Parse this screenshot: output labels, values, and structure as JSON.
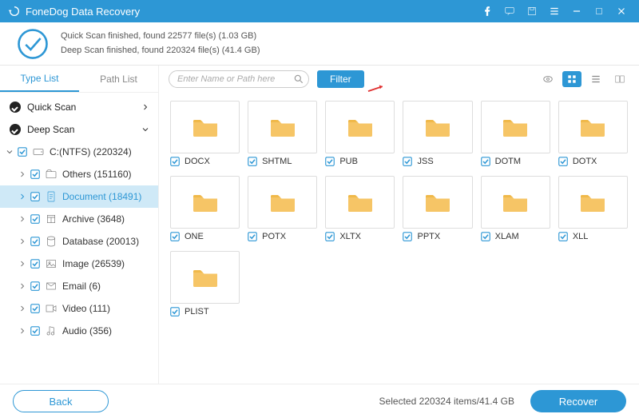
{
  "titlebar": {
    "app_name": "FoneDog Data Recovery"
  },
  "status": {
    "line1": "Quick Scan finished, found 22577 file(s) (1.03 GB)",
    "line2": "Deep Scan finished, found 220324 file(s) (41.4 GB)"
  },
  "sidebar": {
    "tabs": {
      "type_list": "Type List",
      "path_list": "Path List"
    },
    "top": {
      "quick_scan": "Quick Scan",
      "deep_scan": "Deep Scan"
    },
    "drive": "C:(NTFS) (220324)",
    "nodes": [
      {
        "label": "Others (151160)",
        "icon": "folder"
      },
      {
        "label": "Document (18491)",
        "icon": "document",
        "selected": true
      },
      {
        "label": "Archive (3648)",
        "icon": "archive"
      },
      {
        "label": "Database (20013)",
        "icon": "database"
      },
      {
        "label": "Image (26539)",
        "icon": "image"
      },
      {
        "label": "Email (6)",
        "icon": "email"
      },
      {
        "label": "Video (111)",
        "icon": "video"
      },
      {
        "label": "Audio (356)",
        "icon": "audio"
      }
    ]
  },
  "toolbar": {
    "search_placeholder": "Enter Name or Path here",
    "filter_label": "Filter"
  },
  "grid": {
    "items": [
      {
        "label": "DOCX"
      },
      {
        "label": "SHTML"
      },
      {
        "label": "PUB"
      },
      {
        "label": "JSS"
      },
      {
        "label": "DOTM"
      },
      {
        "label": "DOTX"
      },
      {
        "label": "ONE"
      },
      {
        "label": "POTX"
      },
      {
        "label": "XLTX"
      },
      {
        "label": "PPTX"
      },
      {
        "label": "XLAM"
      },
      {
        "label": "XLL"
      },
      {
        "label": "PLIST"
      }
    ]
  },
  "footer": {
    "back_label": "Back",
    "status_text": "Selected 220324 items/41.4 GB",
    "recover_label": "Recover"
  }
}
